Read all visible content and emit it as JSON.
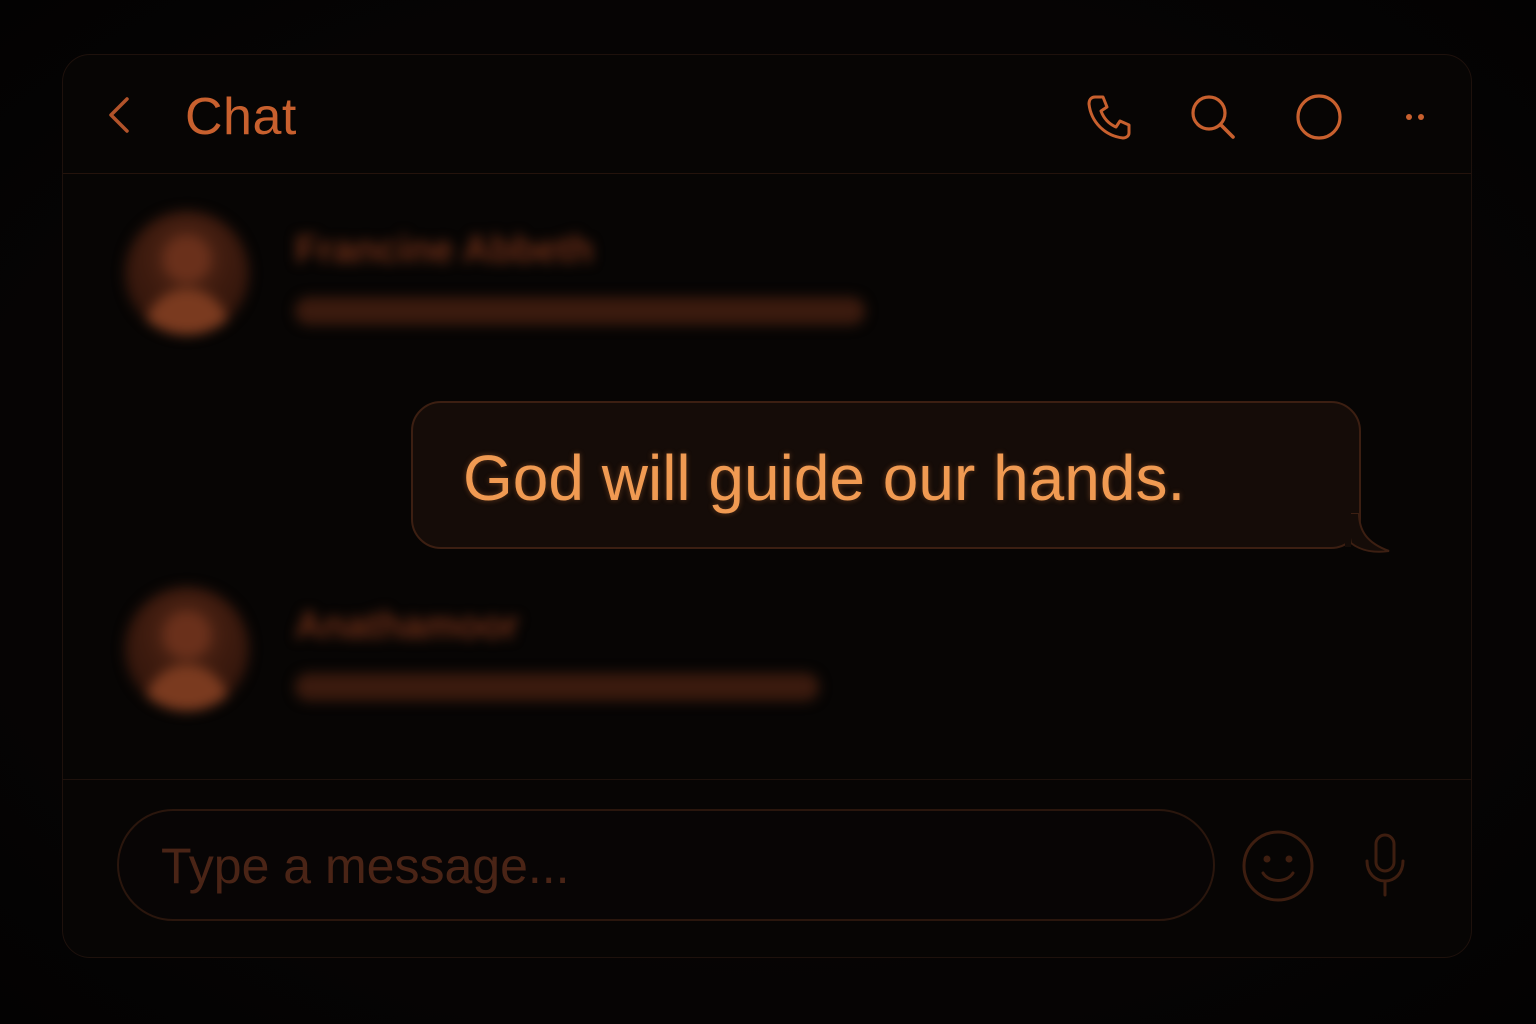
{
  "header": {
    "title": "Chat",
    "back_icon": "chevron-left-icon",
    "actions": [
      "phone-icon",
      "search-icon",
      "circle-icon",
      "more-icon"
    ]
  },
  "messages": [
    {
      "sender": "Francine Abbeth",
      "blurred": true
    },
    {
      "text": "God will guide our hands.",
      "outgoing": true
    },
    {
      "sender": "Anathamoor",
      "blurred": true
    }
  ],
  "composer": {
    "placeholder": "Type a message...",
    "emoji_icon": "smiley-icon",
    "mic_icon": "microphone-icon"
  },
  "colors": {
    "accent": "#c8602e",
    "bubble_text": "#f09a52",
    "background": "#070504"
  }
}
